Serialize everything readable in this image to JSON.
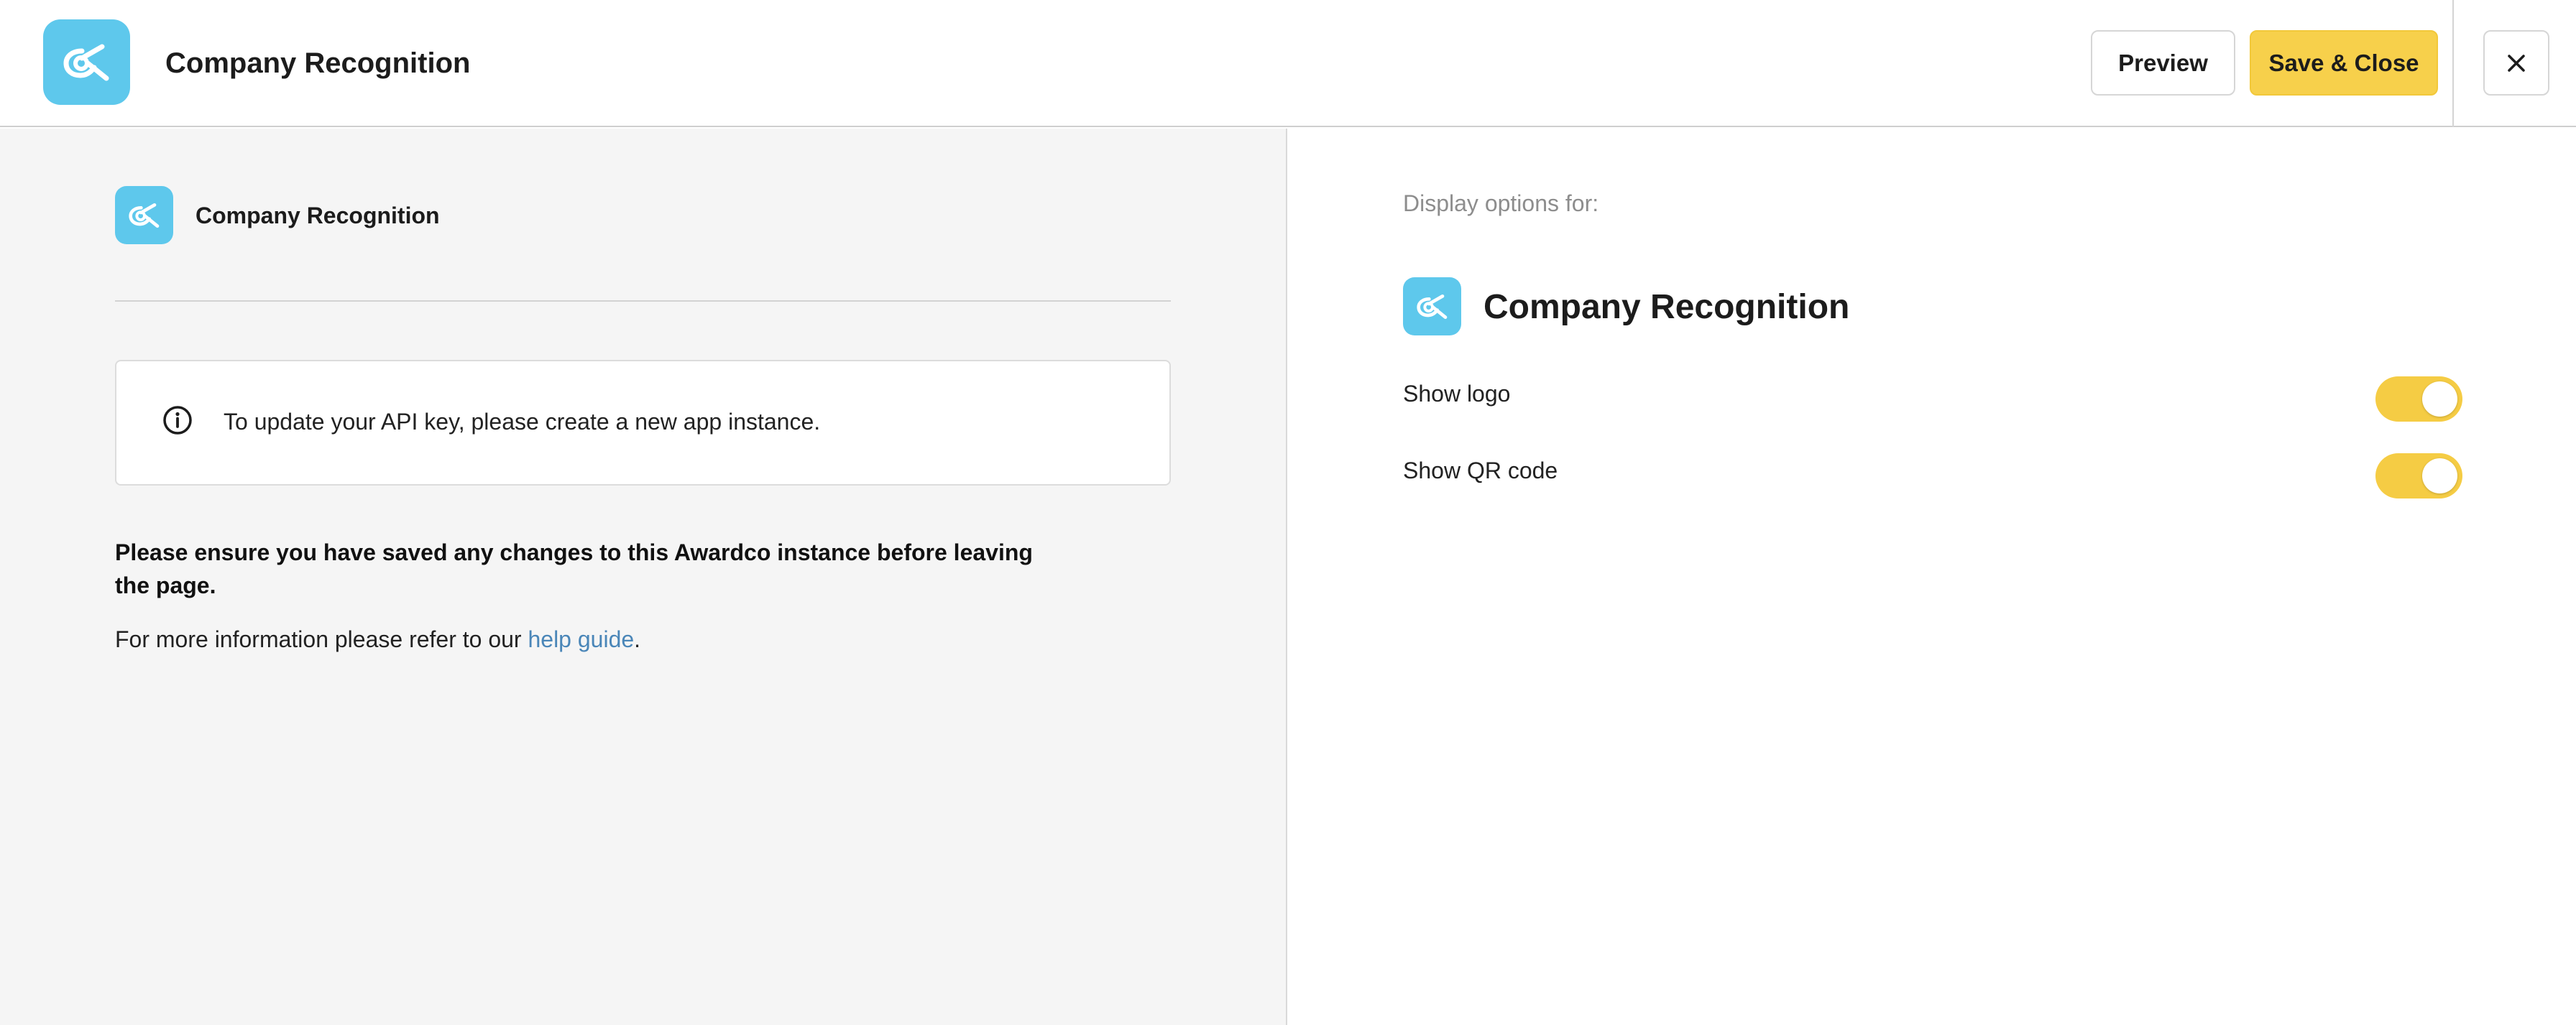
{
  "header": {
    "title": "Company Recognition",
    "preview_label": "Preview",
    "save_label": "Save & Close",
    "logo_icon": "awardco-logo-icon",
    "close_icon": "close-icon"
  },
  "left_panel": {
    "app_name": "Company Recognition",
    "info_message": "To update your API key, please create a new app instance.",
    "warning": "Please ensure you have saved any changes to this Awardco instance before leaving the page.",
    "help_prefix": "For more information please refer to our ",
    "help_link": "help guide",
    "help_suffix": "."
  },
  "right_panel": {
    "display_label": "Display options for:",
    "app_name": "Company Recognition",
    "options": [
      {
        "label": "Show logo",
        "enabled": true
      },
      {
        "label": "Show QR code",
        "enabled": true
      }
    ]
  },
  "colors": {
    "brand": "#5ec8ec",
    "accent": "#f7d04b",
    "link": "#4a86b8"
  }
}
